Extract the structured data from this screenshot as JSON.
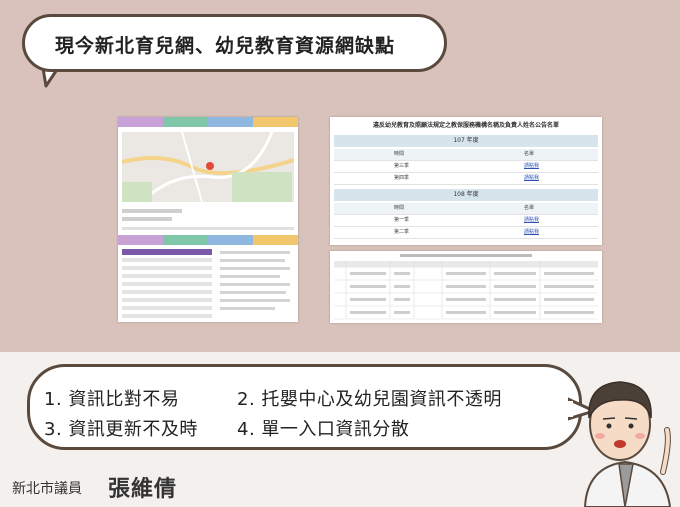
{
  "title": "現今新北育兒網、幼兒教育資源網缺點",
  "issues": [
    "1. 資訊比對不易",
    "2. 托嬰中心及幼兒園資訊不透明",
    "3. 資訊更新不及時",
    "4. 單一入口資訊分散"
  ],
  "footer": {
    "label": "新北市議員",
    "name": "張維倩"
  },
  "screenshot_right_top": {
    "heading": "違反幼兒教育及照顧法規定之教保服務機構名稱及負責人姓名公告名單",
    "years": [
      "107 年度",
      "108 年度"
    ],
    "col_period": "時間",
    "col_list": "名單",
    "rows_107": [
      {
        "period": "第三季",
        "link": "請點我"
      },
      {
        "period": "第四季",
        "link": "請點我"
      }
    ],
    "rows_108": [
      {
        "period": "第一季",
        "link": "請點我"
      },
      {
        "period": "第二季",
        "link": "請點我"
      }
    ]
  },
  "colors": {
    "top_bg": "#d9c2bc",
    "bottom_bg": "#f3f0ed",
    "bubble_border": "#5a4a3e",
    "tab_colors": [
      "#c8a2d6",
      "#7fc7a8",
      "#8fb7e0",
      "#f2c66d"
    ]
  }
}
